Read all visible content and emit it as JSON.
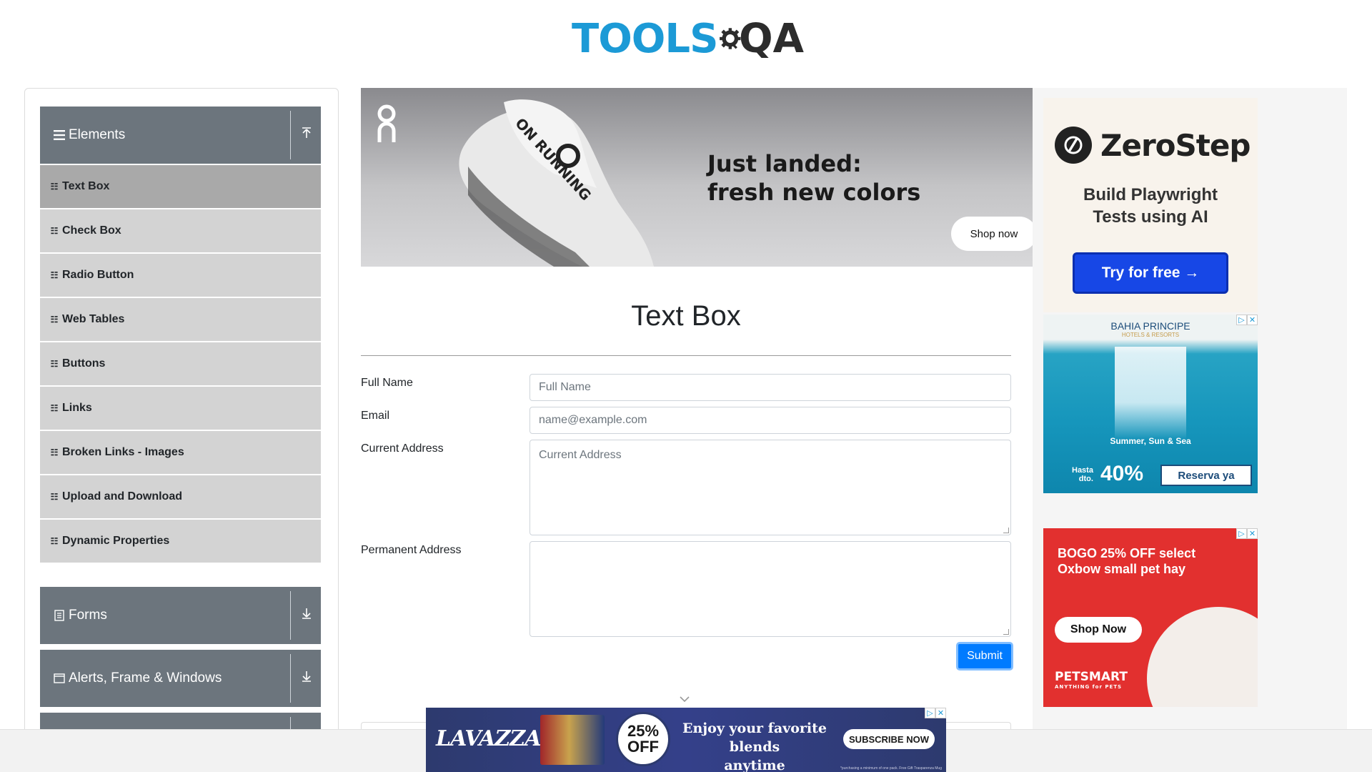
{
  "header": {
    "logo_tools": "TOOLS",
    "logo_qa": "QA"
  },
  "sidebar": {
    "groups": [
      {
        "title": "Elements",
        "icon": "hamburger-icon",
        "expanded": true,
        "items": [
          {
            "label": "Text Box",
            "active": true
          },
          {
            "label": "Check Box"
          },
          {
            "label": "Radio Button"
          },
          {
            "label": "Web Tables"
          },
          {
            "label": "Buttons"
          },
          {
            "label": "Links"
          },
          {
            "label": "Broken Links - Images"
          },
          {
            "label": "Upload and Download"
          },
          {
            "label": "Dynamic Properties"
          }
        ]
      },
      {
        "title": "Forms",
        "icon": "document-icon",
        "expanded": false
      },
      {
        "title": "Alerts, Frame & Windows",
        "icon": "window-icon",
        "expanded": false
      }
    ]
  },
  "top_ad": {
    "brand": "on",
    "shoe_text": "ON RUNNING",
    "headline_1": "Just landed:",
    "headline_2": "fresh new colors",
    "cta": "Shop now"
  },
  "main": {
    "title": "Text Box",
    "form": {
      "full_name_label": "Full Name",
      "full_name_placeholder": "Full Name",
      "email_label": "Email",
      "email_placeholder": "name@example.com",
      "current_address_label": "Current Address",
      "current_address_placeholder": "Current Address",
      "permanent_address_label": "Permanent Address",
      "permanent_address_placeholder": "",
      "submit_label": "Submit"
    }
  },
  "right_ads": {
    "zerostep": {
      "name": "ZeroStep",
      "tagline_1": "Build Playwright",
      "tagline_2": "Tests using AI",
      "cta": "Try for free →"
    },
    "bahia": {
      "brand": "BAHIA PRINCIPE",
      "brand_sub": "HOTELS & RESORTS",
      "tagline": "Summer, Sun & Sea",
      "hasta_1": "Hasta",
      "hasta_2": "dto.",
      "percent": "40%",
      "cta": "Reserva ya"
    },
    "petsmart": {
      "headline_1": "BOGO 25% OFF select",
      "headline_2": "Oxbow small pet hay",
      "cta": "Shop Now",
      "brand": "PETSMART",
      "brand_sub": "ANYTHING for PETS"
    }
  },
  "bottom_ad": {
    "brand": "LAVAZZA",
    "badge_pct": "25%",
    "badge_off": "OFF",
    "text_1": "Enjoy your favorite blends",
    "text_2": "anytime",
    "cta": "SUBSCRIBE NOW",
    "fine_print": "*purchasing a minimum of one pack. Free Gift Trasparenza Mug"
  },
  "colors": {
    "sidebar_header": "#6c757d",
    "menu_item": "#d3d3d3",
    "menu_active": "#a9a9a9",
    "submit": "#007bff",
    "logo_blue": "#1c9ad6"
  }
}
